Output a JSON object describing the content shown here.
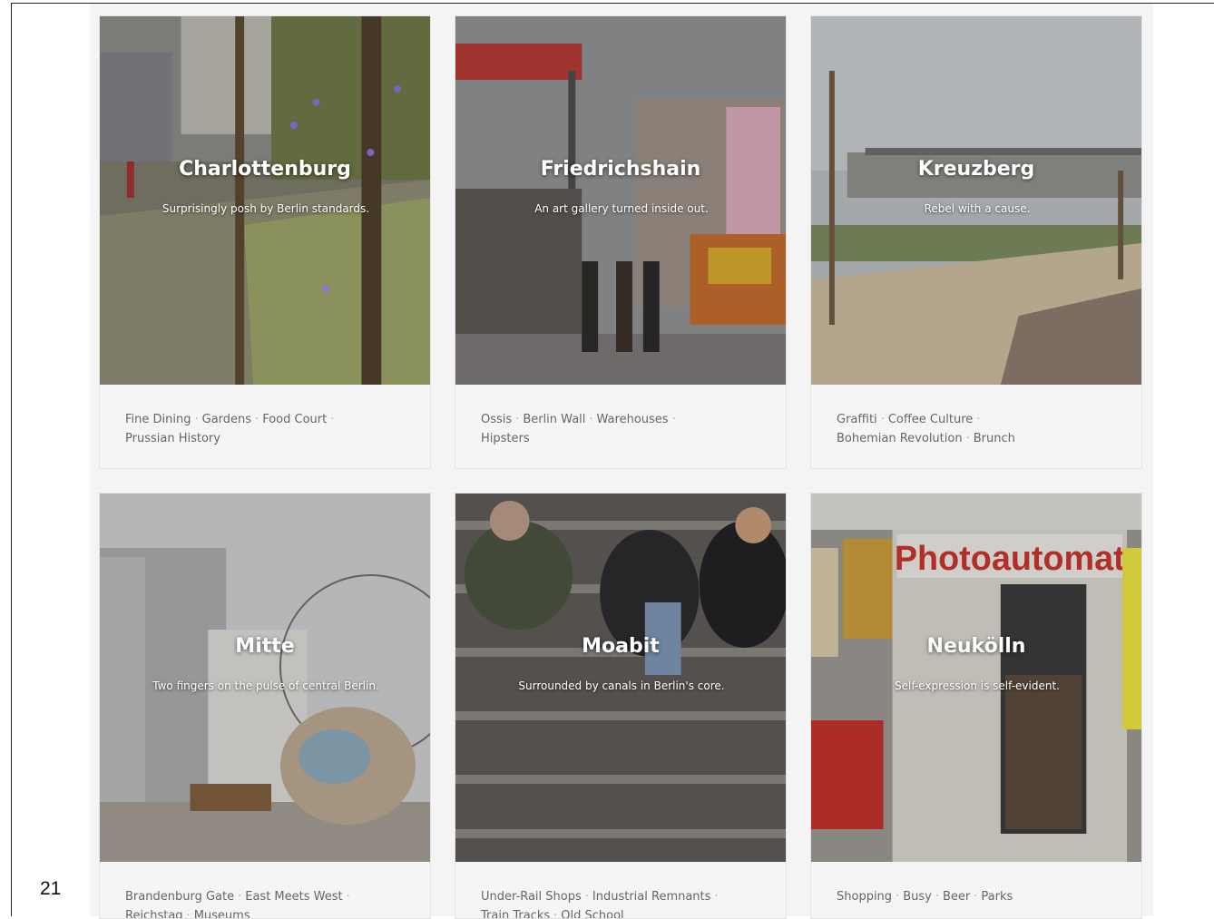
{
  "page_number": "21",
  "cards": [
    {
      "name": "Charlottenburg",
      "tagline": "Surprisingly posh by Berlin standards.",
      "tags": [
        "Fine Dining",
        "Gardens",
        "Food Court",
        "Prussian History"
      ]
    },
    {
      "name": "Friedrichshain",
      "tagline": "An art gallery turned inside out.",
      "tags": [
        "Ossis",
        "Berlin Wall",
        "Warehouses",
        "Hipsters"
      ]
    },
    {
      "name": "Kreuzberg",
      "tagline": "Rebel with a cause.",
      "tags": [
        "Graffiti",
        "Coffee Culture",
        "Bohemian Revolution",
        "Brunch"
      ]
    },
    {
      "name": "Mitte",
      "tagline": "Two fingers on the pulse of central Berlin.",
      "tags": [
        "Brandenburg Gate",
        "East Meets West",
        "Reichstag",
        "Museums"
      ]
    },
    {
      "name": "Moabit",
      "tagline": "Surrounded by canals in Berlin's core.",
      "tags": [
        "Under-Rail Shops",
        "Industrial Remnants",
        "Train Tracks",
        "Old School"
      ]
    },
    {
      "name": "Neukölln",
      "tagline": "Self-expression is self-evident.",
      "tags": [
        "Shopping",
        "Busy",
        "Beer",
        "Parks"
      ]
    }
  ],
  "photo_signs": {
    "photoautomat": "Photoautomat"
  },
  "colors": {
    "card_bg": "#f5f5f5",
    "tag_text": "#666666",
    "overlay_text": "#ffffff"
  }
}
